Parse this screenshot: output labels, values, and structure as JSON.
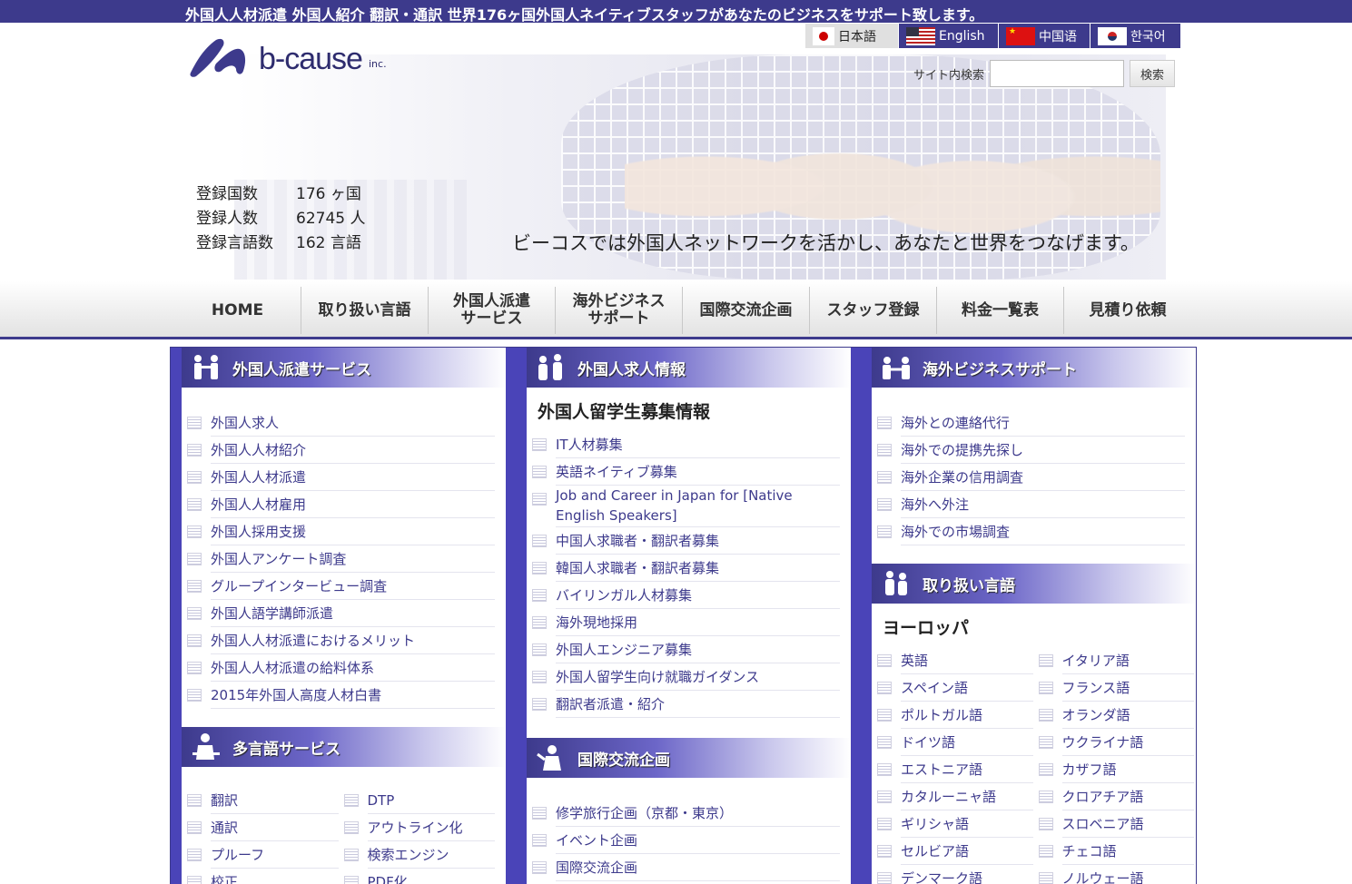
{
  "topbar": {
    "text": "外国人人材派遣 外国人紹介 翻訳・通訳 世界176ヶ国外国人ネイティブスタッフがあなたのビジネスをサポート致します。"
  },
  "logo": {
    "word": "b-cause",
    "inc": "inc."
  },
  "languages": [
    {
      "label": "日本語",
      "icon": "japan-flag-icon"
    },
    {
      "label": "English",
      "icon": "us-flag-icon"
    },
    {
      "label": "中国语",
      "icon": "china-flag-icon"
    },
    {
      "label": "한국어",
      "icon": "korea-flag-icon"
    }
  ],
  "search": {
    "label": "サイト内検索",
    "value": "",
    "button": "検索"
  },
  "stats": [
    {
      "key": "登録国数",
      "value": "176 ヶ国"
    },
    {
      "key": "登録人数",
      "value": "62745 人"
    },
    {
      "key": "登録言語数",
      "value": "162 言語"
    }
  ],
  "tagline": "ビーコスでは外国人ネットワークを活かし、あなたと世界をつなげます。",
  "nav": [
    "HOME",
    "取り扱い言語",
    "外国人派遣\nサービス",
    "海外ビジネス\nサポート",
    "国際交流企画",
    "スタッフ登録",
    "料金一覧表",
    "見積り依頼"
  ],
  "col1": {
    "panel1": {
      "title": "外国人派遣サービス",
      "items": [
        "外国人求人",
        "外国人人材紹介",
        "外国人人材派遣",
        "外国人人材雇用",
        "外国人採用支援",
        "外国人アンケート調査",
        "グループインタービュー調査",
        "外国人語学講師派遣",
        "外国人人材派遣におけるメリット",
        "外国人人材派遣の給料体系",
        "2015年外国人高度人材白書"
      ]
    },
    "panel2": {
      "title": "多言語サービス",
      "left": [
        "翻訳",
        "通訳",
        "プルーフ",
        "校正"
      ],
      "right": [
        "DTP",
        "アウトライン化",
        "検索エンジン",
        "PDF化"
      ]
    }
  },
  "col2": {
    "panel1": {
      "title": "外国人求人情報",
      "subhead": "外国人留学生募集情報",
      "items": [
        "IT人材募集",
        "英語ネイティブ募集",
        "Job and Career in Japan for [Native English Speakers]",
        "中国人求職者・翻訳者募集",
        "韓国人求職者・翻訳者募集",
        "バイリンガル人材募集",
        "海外現地採用",
        "外国人エンジニア募集",
        "外国人留学生向け就職ガイダンス",
        "翻訳者派遣・紹介"
      ]
    },
    "panel2": {
      "title": "国際交流企画",
      "items": [
        "修学旅行企画（京都・東京）",
        "イベント企画",
        "国際交流企画"
      ]
    }
  },
  "col3": {
    "panel1": {
      "title": "海外ビジネスサポート",
      "items": [
        "海外との連絡代行",
        "海外での提携先探し",
        "海外企業の信用調査",
        "海外へ外注",
        "海外での市場調査"
      ]
    },
    "panel2": {
      "title": "取り扱い言語",
      "subhead": "ヨーロッパ",
      "left": [
        "英語",
        "スペイン語",
        "ポルトガル語",
        "ドイツ語",
        "エストニア語",
        "カタルーニャ語",
        "ギリシャ語",
        "セルビア語",
        "デンマーク語"
      ],
      "right": [
        "イタリア語",
        "フランス語",
        "オランダ語",
        "ウクライナ語",
        "カザフ語",
        "クロアチア語",
        "スロベニア語",
        "チェコ語",
        "ノルウェー語"
      ]
    }
  },
  "colors": {
    "brand": "#3d3a8c",
    "column": "#4a44b8"
  }
}
